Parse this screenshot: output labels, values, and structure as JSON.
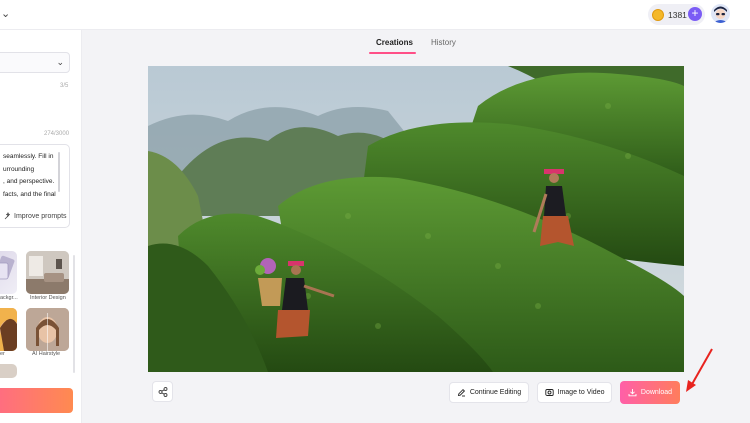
{
  "header": {
    "credits": "1381",
    "plus_label": "+"
  },
  "left_panel": {
    "char_count_top": "3/5",
    "char_count_prompt": "274/3000",
    "prompt_lines": [
      "seamlessly. Fill in",
      "urrounding",
      ", and perspective.",
      "facts, and the final"
    ],
    "improve_label": "Improve prompts",
    "presets": [
      {
        "label": "ackgr..."
      },
      {
        "label": "Interior Design"
      },
      {
        "label": "er"
      },
      {
        "label": "AI Hairstyle"
      }
    ]
  },
  "tabs": [
    {
      "label": "Creations",
      "active": true
    },
    {
      "label": "History",
      "active": false
    }
  ],
  "actions": {
    "continue_editing": "Continue Editing",
    "image_to_video": "Image to Video",
    "download": "Download"
  },
  "colors": {
    "accent_pink": "#ff4f87",
    "download_gradient_start": "#ff5fa8",
    "download_gradient_end": "#ff7d5c",
    "annotation_arrow": "#e8231f"
  }
}
